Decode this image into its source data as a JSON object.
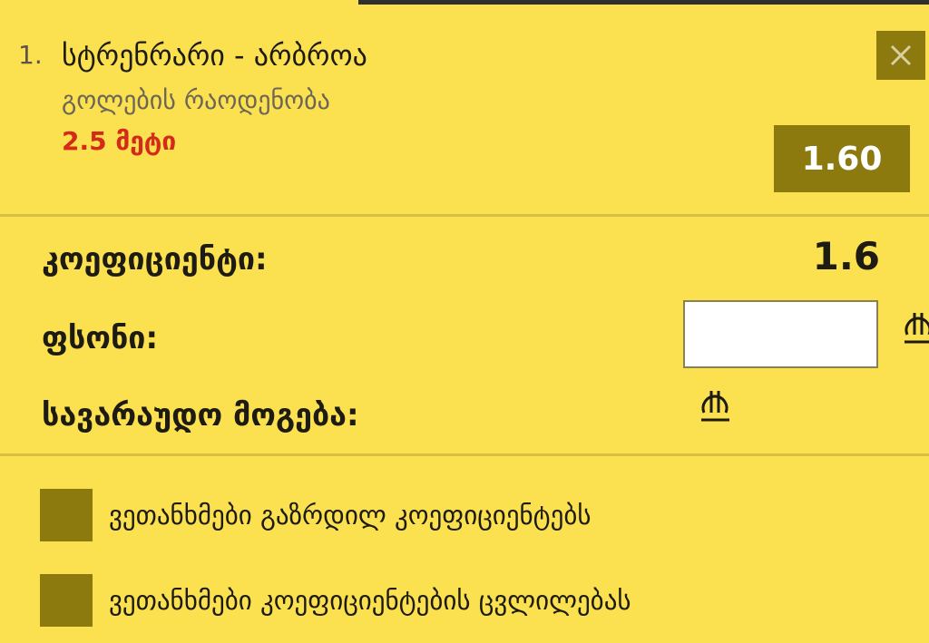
{
  "bet": {
    "index": "1.",
    "match": "სტრენრარი - არბროა",
    "market": "გოლების რაოდენობა",
    "selection": "2.5 მეტი",
    "odd": "1.60"
  },
  "summary": {
    "odd_label": "კოეფიციენტი:",
    "odd_value": "1.6",
    "stake_label": "ფსონი:",
    "stake_value": "",
    "win_label": "სავარაუდო მოგება:",
    "currency": "₾"
  },
  "options": [
    {
      "label": "ვეთანხმები გაზრდილ კოეფიციენტებს",
      "checked": false
    },
    {
      "label": "ვეთანხმები კოეფიციენტების ცვლილებას",
      "checked": false
    }
  ],
  "icons": {
    "close": "close-icon",
    "currency": "lari-currency-icon",
    "checkbox": "checkbox-icon"
  },
  "colors": {
    "background": "#fbe04f",
    "accent": "#8d7a0f",
    "selection_red": "#d32a1a",
    "divider": "#d7bf45"
  }
}
